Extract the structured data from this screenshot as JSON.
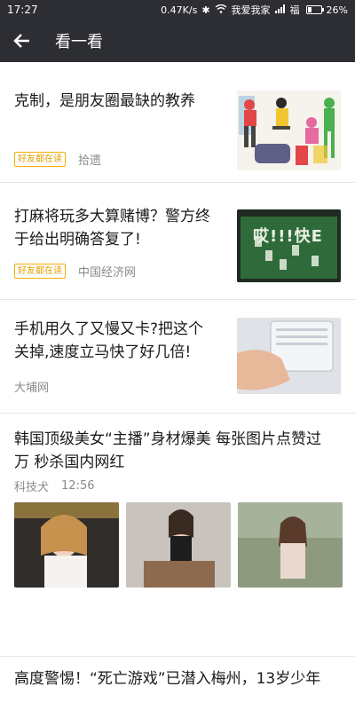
{
  "status_bar": {
    "time": "17:27",
    "net_speed": "0.47K/s",
    "carrier": "我爱我家",
    "signal_label": "福",
    "battery": "26%",
    "battery_level": 0.26
  },
  "nav": {
    "back_icon": "back-arrow-icon",
    "title": "看一看"
  },
  "articles": [
    {
      "title_lines": [
        "克制，是朋友圈最缺的教养"
      ],
      "badge": "好友都在读",
      "source": "拾遗"
    },
    {
      "title_lines": [
        "打麻将玩多大算赌博？警方终",
        "于给出明确答复了!"
      ],
      "badge": "好友都在读",
      "source": "中国经济网"
    },
    {
      "title_lines": [
        "手机用久了又慢又卡?把这个",
        "关掉,速度立马快了好几倍!"
      ],
      "source": "大埔网"
    },
    {
      "title_lines": [
        "韩国顶级美女“主播”身材爆美 每张图片点赞过",
        "万 秒杀国内网红"
      ],
      "source": "科技犬",
      "time": "12:56"
    },
    {
      "title_lines": [
        "高度警惕！“死亡游戏”已潜入梅州，13岁少年"
      ]
    }
  ],
  "thumb_text": {
    "mahjong_caption": "哎!!!快E"
  }
}
